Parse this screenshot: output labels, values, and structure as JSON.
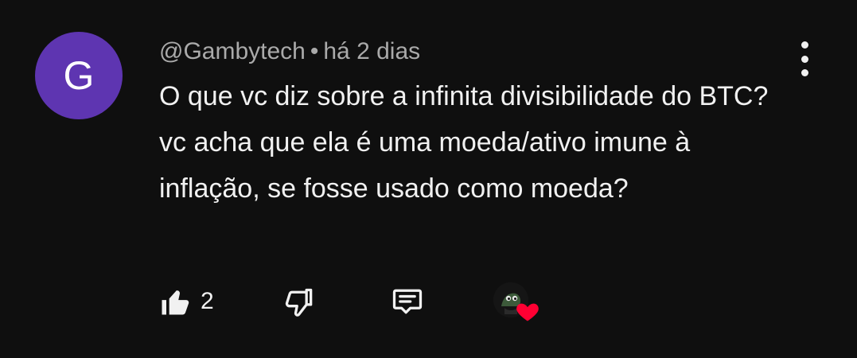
{
  "comment": {
    "avatar_letter": "G",
    "avatar_color": "#5e35b1",
    "author": "@Gambytech",
    "separator": "•",
    "timestamp": "há 2 dias",
    "text": "O que vc diz sobre a infinita divisibilidade do BTC? vc acha que ela é uma moeda/ativo imune à inflação, se fosse usado como moeda?",
    "menu_icon": "more-vert-icon"
  },
  "actions": {
    "like_icon": "thumb-up-filled-icon",
    "like_count": "2",
    "dislike_icon": "thumb-down-icon",
    "reply_icon": "reply-comment-icon",
    "creator_heart_icon": "creator-heart-icon",
    "heart_color": "#ff0033"
  }
}
